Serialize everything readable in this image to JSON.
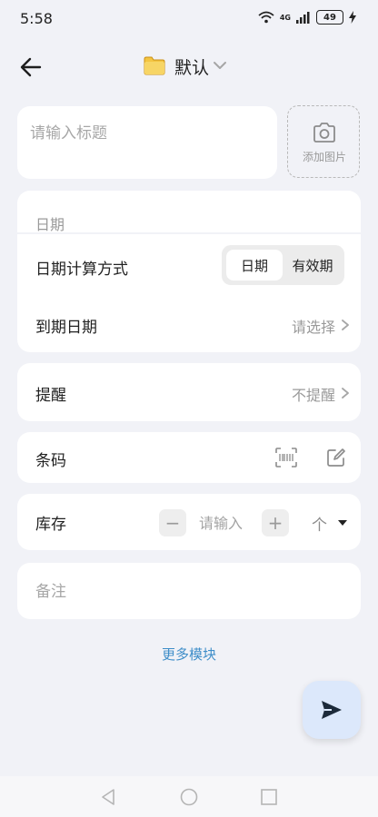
{
  "status": {
    "time": "5:58",
    "network": "4G",
    "battery": "49"
  },
  "header": {
    "folder_title": "默认"
  },
  "title": {
    "placeholder": "请输入标题",
    "add_image_label": "添加图片"
  },
  "date": {
    "section_header": "日期",
    "calc_label": "日期计算方式",
    "calc_options": [
      "日期",
      "有效期"
    ],
    "calc_selected": "日期",
    "due_label": "到期日期",
    "due_value": "请选择"
  },
  "reminder": {
    "label": "提醒",
    "value": "不提醒"
  },
  "barcode": {
    "label": "条码"
  },
  "stock": {
    "label": "库存",
    "placeholder": "请输入",
    "minus": "−",
    "plus": "+",
    "unit": "个"
  },
  "note": {
    "placeholder": "备注"
  },
  "more_modules": "更多模块"
}
